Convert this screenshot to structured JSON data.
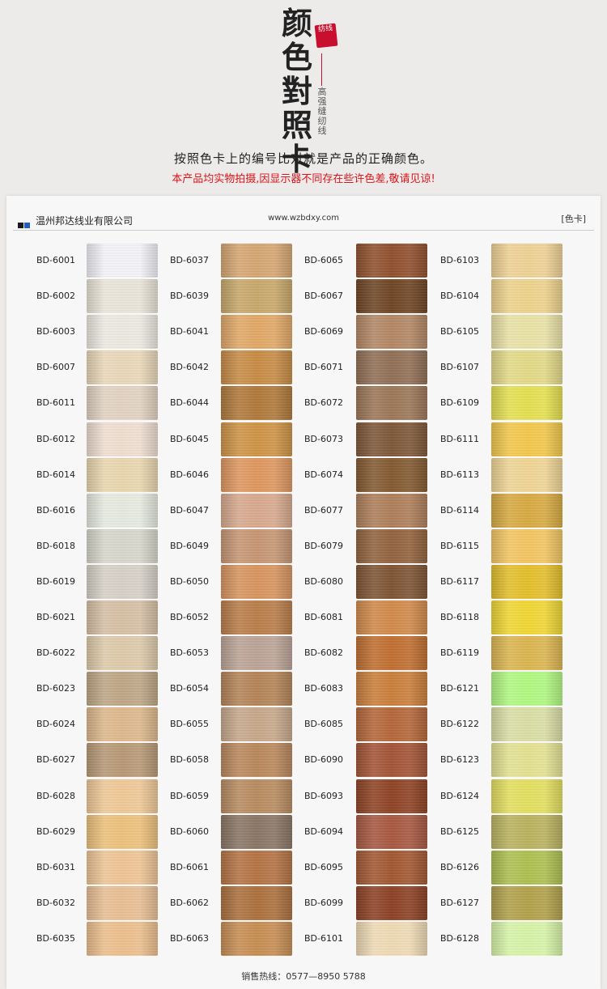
{
  "header": {
    "title_chars": [
      "颜",
      "色",
      "對",
      "照",
      "卡"
    ],
    "seal_text": "纺线",
    "subtitle_chars": [
      "高",
      "强",
      "缝",
      "纫",
      "线"
    ],
    "instruction": "按照色卡上的编号比对就是产品的正确颜色。",
    "notice": "本产品均实物拍摄,因显示器不同存在些许色差,敬请见谅!"
  },
  "card": {
    "company": "温州邦达线业有限公司",
    "website": "www.wzbdxy.com",
    "label": "[色卡]",
    "hotline": "销售热线：0577—8950 5788",
    "logo_colors": [
      "#1a1a1a",
      "#1f5fbf"
    ]
  },
  "columns": [
    {
      "swatches": [
        {
          "code": "BD-6001",
          "color": "#f6f6fb"
        },
        {
          "code": "BD-6002",
          "color": "#ece7da"
        },
        {
          "code": "BD-6003",
          "color": "#efece3"
        },
        {
          "code": "BD-6007",
          "color": "#ecd9b9"
        },
        {
          "code": "BD-6011",
          "color": "#e4d4c2"
        },
        {
          "code": "BD-6012",
          "color": "#f1e0d1"
        },
        {
          "code": "BD-6014",
          "color": "#ecd8ae"
        },
        {
          "code": "BD-6016",
          "color": "#e8ede2"
        },
        {
          "code": "BD-6018",
          "color": "#d9d8cd"
        },
        {
          "code": "BD-6019",
          "color": "#d8d2c8"
        },
        {
          "code": "BD-6021",
          "color": "#d8c0a4"
        },
        {
          "code": "BD-6022",
          "color": "#e0cba9"
        },
        {
          "code": "BD-6023",
          "color": "#bea582"
        },
        {
          "code": "BD-6024",
          "color": "#e0b88a"
        },
        {
          "code": "BD-6027",
          "color": "#b79772"
        },
        {
          "code": "BD-6028",
          "color": "#f2c995"
        },
        {
          "code": "BD-6029",
          "color": "#f0c178"
        },
        {
          "code": "BD-6031",
          "color": "#f1c593"
        },
        {
          "code": "BD-6032",
          "color": "#ebbf92"
        },
        {
          "code": "BD-6035",
          "color": "#efbf8b"
        }
      ]
    },
    {
      "swatches": [
        {
          "code": "BD-6037",
          "color": "#d7a56e"
        },
        {
          "code": "BD-6039",
          "color": "#c9a766"
        },
        {
          "code": "BD-6041",
          "color": "#e3a762"
        },
        {
          "code": "BD-6042",
          "color": "#c8893e"
        },
        {
          "code": "BD-6044",
          "color": "#b07533"
        },
        {
          "code": "BD-6045",
          "color": "#cf913f"
        },
        {
          "code": "BD-6046",
          "color": "#e0955a"
        },
        {
          "code": "BD-6047",
          "color": "#d9a88b"
        },
        {
          "code": "BD-6049",
          "color": "#c79470"
        },
        {
          "code": "BD-6050",
          "color": "#d9925a"
        },
        {
          "code": "BD-6052",
          "color": "#b97a43"
        },
        {
          "code": "BD-6053",
          "color": "#bba294"
        },
        {
          "code": "BD-6054",
          "color": "#b48152"
        },
        {
          "code": "BD-6055",
          "color": "#c7a788"
        },
        {
          "code": "BD-6058",
          "color": "#b98557"
        },
        {
          "code": "BD-6059",
          "color": "#b8895b"
        },
        {
          "code": "BD-6060",
          "color": "#877260"
        },
        {
          "code": "BD-6061",
          "color": "#b46f3d"
        },
        {
          "code": "BD-6062",
          "color": "#ab6c36"
        },
        {
          "code": "BD-6063",
          "color": "#c78b4d"
        }
      ]
    },
    {
      "swatches": [
        {
          "code": "BD-6065",
          "color": "#8e4a26"
        },
        {
          "code": "BD-6067",
          "color": "#6a3e1c"
        },
        {
          "code": "BD-6069",
          "color": "#b28460"
        },
        {
          "code": "BD-6071",
          "color": "#8e6b50"
        },
        {
          "code": "BD-6072",
          "color": "#9a7352"
        },
        {
          "code": "BD-6073",
          "color": "#7a5231"
        },
        {
          "code": "BD-6074",
          "color": "#805429"
        },
        {
          "code": "BD-6077",
          "color": "#ad7b55"
        },
        {
          "code": "BD-6079",
          "color": "#8f5e37"
        },
        {
          "code": "BD-6080",
          "color": "#7a4e2c"
        },
        {
          "code": "BD-6081",
          "color": "#d28744"
        },
        {
          "code": "BD-6082",
          "color": "#c06a28"
        },
        {
          "code": "BD-6083",
          "color": "#cb7b34"
        },
        {
          "code": "BD-6085",
          "color": "#b46232"
        },
        {
          "code": "BD-6090",
          "color": "#a24e2f"
        },
        {
          "code": "BD-6093",
          "color": "#8c3c1c"
        },
        {
          "code": "BD-6094",
          "color": "#a6523a"
        },
        {
          "code": "BD-6095",
          "color": "#a0522a"
        },
        {
          "code": "BD-6099",
          "color": "#8a3a1d"
        },
        {
          "code": "BD-6101",
          "color": "#f1dcb4"
        }
      ]
    },
    {
      "swatches": [
        {
          "code": "BD-6103",
          "color": "#f2d293"
        },
        {
          "code": "BD-6104",
          "color": "#f0d489"
        },
        {
          "code": "BD-6105",
          "color": "#ece4a5"
        },
        {
          "code": "BD-6107",
          "color": "#e5dc84"
        },
        {
          "code": "BD-6109",
          "color": "#e7e24b"
        },
        {
          "code": "BD-6111",
          "color": "#f5c846"
        },
        {
          "code": "BD-6113",
          "color": "#f2d693"
        },
        {
          "code": "BD-6114",
          "color": "#d9a93b"
        },
        {
          "code": "BD-6115",
          "color": "#f6c65d"
        },
        {
          "code": "BD-6117",
          "color": "#e6bf24"
        },
        {
          "code": "BD-6118",
          "color": "#f3d82c"
        },
        {
          "code": "BD-6119",
          "color": "#ddb54a"
        },
        {
          "code": "BD-6121",
          "color": "#b0fb7e"
        },
        {
          "code": "BD-6122",
          "color": "#dce0a4"
        },
        {
          "code": "BD-6123",
          "color": "#e6e48f"
        },
        {
          "code": "BD-6124",
          "color": "#e5e15a"
        },
        {
          "code": "BD-6125",
          "color": "#b9b25a"
        },
        {
          "code": "BD-6126",
          "color": "#acc04a"
        },
        {
          "code": "BD-6127",
          "color": "#b1a045"
        },
        {
          "code": "BD-6128",
          "color": "#d8f7a7"
        }
      ]
    }
  ]
}
